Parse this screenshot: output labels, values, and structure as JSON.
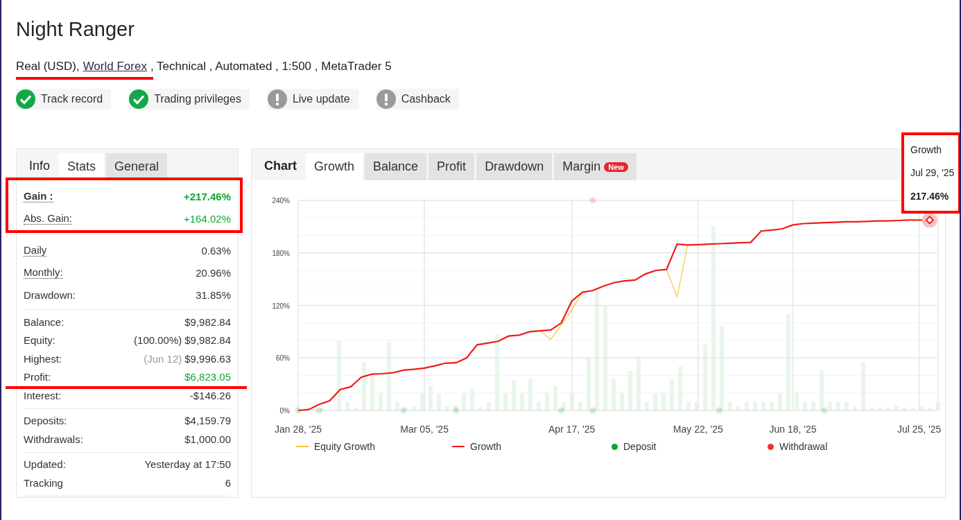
{
  "title": "Night Ranger",
  "account_line": {
    "prefix": "Real (USD),",
    "broker": "World Forex",
    "rest": ", Technical , Automated , 1:500 , MetaTrader 5"
  },
  "badges": [
    {
      "label": "Track record",
      "verified": true
    },
    {
      "label": "Trading privileges",
      "verified": true
    },
    {
      "label": "Live update",
      "verified": false
    },
    {
      "label": "Cashback",
      "verified": false
    }
  ],
  "stats_panel": {
    "heading": "Info",
    "tabs": [
      {
        "label": "Stats",
        "selected": true
      },
      {
        "label": "General",
        "selected": false
      }
    ],
    "groups": [
      [
        {
          "label": "Gain :",
          "value": "+217.46%",
          "positive": true,
          "bold": true,
          "underlined": true
        },
        {
          "label": "Abs. Gain:",
          "value": "+164.02%",
          "positive": true,
          "bold": false,
          "underlined": true
        },
        {
          "label": "Daily",
          "value": "0.63%",
          "positive": false,
          "bold": false,
          "underlined": true
        },
        {
          "label": "Monthly:",
          "value": "20.96%",
          "positive": false,
          "bold": false,
          "underlined": true
        },
        {
          "label": "Drawdown:",
          "value": "31.85%",
          "positive": false,
          "bold": false,
          "underlined": false
        }
      ],
      [
        {
          "label": "Balance:",
          "value": "$9,982.84",
          "positive": false,
          "bold": false,
          "underlined": false
        },
        {
          "label": "Equity:",
          "note": "(100.00%)",
          "value": "$9,982.84",
          "positive": false,
          "bold": false,
          "underlined": false
        },
        {
          "label": "Highest:",
          "note": "(Jun 12)",
          "value": "$9,996.63",
          "positive": false,
          "bold": false,
          "underlined": false
        },
        {
          "label": "Profit:",
          "value": "$6,823.05",
          "positive": true,
          "bold": false,
          "underlined": false
        },
        {
          "label": "Interest:",
          "value": "-$146.26",
          "positive": false,
          "bold": false,
          "underlined": false
        }
      ],
      [
        {
          "label": "Deposits:",
          "value": "$4,159.79",
          "positive": false,
          "bold": false,
          "underlined": false
        },
        {
          "label": "Withdrawals:",
          "value": "$1,000.00",
          "positive": false,
          "bold": false,
          "underlined": false
        }
      ],
      [
        {
          "label": "Updated:",
          "value": "Yesterday at 17:50",
          "positive": false,
          "bold": false,
          "underlined": false
        },
        {
          "label": "Tracking",
          "value": "6",
          "positive": false,
          "bold": false,
          "underlined": false
        }
      ]
    ]
  },
  "chart_panel": {
    "heading": "Chart",
    "tabs": [
      {
        "label": "Growth",
        "selected": true
      },
      {
        "label": "Balance",
        "selected": false
      },
      {
        "label": "Profit",
        "selected": false
      },
      {
        "label": "Drawdown",
        "selected": false
      },
      {
        "label": "Margin",
        "selected": false,
        "badge": "New"
      }
    ],
    "chart_data": {
      "type": "line",
      "categories": [
        "Jan 28, '25",
        null,
        null,
        null,
        null,
        null,
        null,
        null,
        null,
        null,
        null,
        null,
        "Mar 05, '25",
        null,
        null,
        null,
        null,
        null,
        null,
        null,
        null,
        null,
        null,
        null,
        null,
        null,
        "Apr 17, '25",
        null,
        null,
        null,
        null,
        null,
        null,
        null,
        null,
        null,
        null,
        null,
        "May 22, '25",
        null,
        null,
        null,
        null,
        null,
        null,
        null,
        null,
        "Jun 18, '25",
        null,
        null,
        null,
        null,
        null,
        null,
        null,
        null,
        null,
        null,
        null,
        "Jul 25, '25",
        null
      ],
      "ylim": [
        0,
        240
      ],
      "grid": true,
      "yticks": [
        {
          "value": 0,
          "label": "0%"
        },
        {
          "value": 60,
          "label": "60%"
        },
        {
          "value": 120,
          "label": "120%"
        },
        {
          "value": 180,
          "label": "180%"
        },
        {
          "value": 240,
          "label": "240%"
        }
      ],
      "series": [
        {
          "name": "Equity Growth",
          "color": "#f5c542",
          "values": [
            null,
            null,
            null,
            null,
            null,
            null,
            null,
            null,
            null,
            null,
            null,
            null,
            null,
            null,
            null,
            null,
            null,
            null,
            null,
            null,
            null,
            null,
            null,
            91,
            81,
            98,
            115,
            135,
            null,
            null,
            null,
            null,
            null,
            null,
            null,
            161,
            130,
            189,
            null,
            null,
            null,
            null,
            null,
            null,
            null,
            null,
            null,
            null,
            null,
            null,
            null,
            null,
            null,
            null,
            null,
            null,
            null,
            null,
            null,
            null,
            null
          ]
        },
        {
          "name": "Growth",
          "color": "#ee1c1c",
          "values": [
            0,
            1,
            7,
            11,
            24,
            27,
            38,
            41.5,
            42,
            43,
            46,
            47,
            48.5,
            51,
            54,
            54.5,
            60,
            75,
            77,
            79,
            85,
            86,
            90,
            91,
            92,
            100,
            125,
            135,
            137,
            142,
            146,
            148,
            149,
            156,
            160,
            161,
            190,
            189,
            189.5,
            190,
            190.5,
            191,
            191.5,
            192,
            205,
            206,
            207.5,
            212,
            213.5,
            214,
            214.5,
            215,
            215.5,
            215.5,
            216,
            216.5,
            216.5,
            217,
            217.5,
            217.5,
            217.5
          ]
        },
        {
          "name": "Deposit",
          "color": "#0ca82e",
          "type": "scatter",
          "marker": "circle",
          "values": [
            0,
            null,
            0,
            null,
            null,
            null,
            null,
            null,
            null,
            null,
            0,
            null,
            null,
            null,
            null,
            0,
            null,
            null,
            null,
            null,
            null,
            null,
            null,
            null,
            null,
            0,
            null,
            null,
            0,
            null,
            null,
            null,
            null,
            null,
            null,
            null,
            null,
            null,
            null,
            null,
            0,
            null,
            null,
            null,
            null,
            null,
            null,
            null,
            null,
            null,
            0,
            null,
            null,
            null,
            null,
            null,
            null,
            null,
            null,
            null,
            null
          ]
        },
        {
          "name": "Withdrawal",
          "color": "#ee3333",
          "type": "scatter",
          "marker": "circle",
          "values": [
            null,
            null,
            null,
            null,
            null,
            null,
            null,
            null,
            null,
            null,
            null,
            null,
            null,
            null,
            null,
            null,
            null,
            null,
            null,
            null,
            null,
            null,
            null,
            null,
            null,
            null,
            null,
            null,
            240,
            null,
            null,
            null,
            null,
            null,
            null,
            null,
            null,
            null,
            null,
            null,
            null,
            null,
            null,
            null,
            null,
            null,
            null,
            null,
            null,
            null,
            null,
            null,
            null,
            null,
            null,
            null,
            null,
            null,
            null,
            null,
            null
          ]
        }
      ]
    },
    "tooltip": {
      "series": "Growth",
      "date": "Jul 29, '25",
      "value": "217.46%"
    }
  }
}
